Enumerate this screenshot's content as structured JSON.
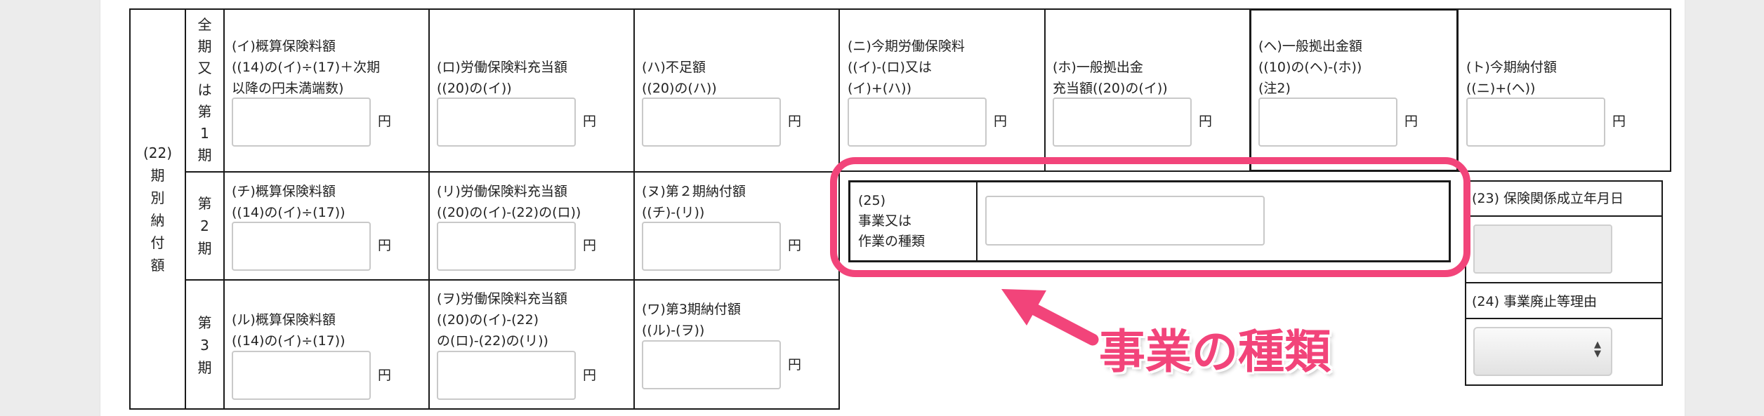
{
  "installments": {
    "group_label": [
      "(22)",
      "期",
      "別",
      "納",
      "付",
      "額"
    ],
    "period1": {
      "label": [
        "全",
        "期",
        "又",
        "は",
        "第",
        "1",
        "期"
      ],
      "i": [
        "(イ)概算保険料額",
        "((14)の(イ)÷(17)＋次期",
        "以降の円未満端数)"
      ],
      "ro": [
        "(ロ)労働保険料充当額",
        "((20)の(イ))"
      ],
      "ha": [
        "(ハ)不足額",
        "((20)の(ハ))"
      ],
      "ni": [
        "(ニ)今期労働保険料",
        "((イ)-(ロ)又は",
        "(イ)+(ハ))"
      ],
      "ho": [
        "(ホ)一般拠出金",
        "充当額((20)の(イ))"
      ],
      "he": [
        "(ヘ)一般拠出金額",
        "((10)の(ヘ)-(ホ))",
        "(注2)"
      ],
      "to": [
        "(ト)今期納付額",
        "((ニ)+(ヘ))"
      ]
    },
    "period2": {
      "label": [
        "第",
        "2",
        "期"
      ],
      "chi": [
        "(チ)概算保険料額",
        "((14)の(イ)÷(17))"
      ],
      "ri": [
        "(リ)労働保険料充当額",
        "((20)の(イ)-(22)の(ロ))"
      ],
      "nu": [
        "(ヌ)第２期納付額",
        "((チ)-(リ))"
      ]
    },
    "period3": {
      "label": [
        "第",
        "3",
        "期"
      ],
      "ru": [
        "(ル)概算保険料額",
        "((14)の(イ)÷(17))"
      ],
      "wo": [
        "(ヲ)労働保険料充当額",
        "((20)の(イ)-(22)",
        "の(ロ)-(22)の(リ))"
      ],
      "wa": [
        "(ワ)第3期納付額",
        "((ル)-(ヲ))"
      ]
    },
    "yen": "円"
  },
  "business_type": {
    "label": [
      "(25)",
      "事業又は",
      "作業の種類"
    ],
    "value": ""
  },
  "insurance_established": {
    "label": "(23) 保険関係成立年月日",
    "value": ""
  },
  "abolition_reason": {
    "label": "(24) 事業廃止等理由",
    "selected": ""
  },
  "annotation": {
    "text": "事業の種類",
    "color": "#f2447a"
  }
}
